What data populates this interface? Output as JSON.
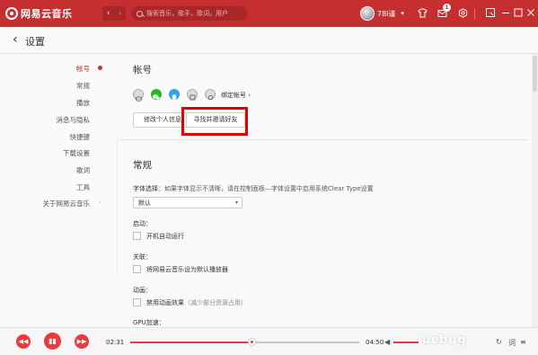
{
  "app": {
    "logo_text": "网易云音乐"
  },
  "titlebar": {
    "back": "‹",
    "forward": "›",
    "search_placeholder": "搜索音乐，歌手，歌词，用户",
    "username": "78l谨",
    "caret": "▾",
    "message_badge": "1",
    "icons": [
      "skin-icon",
      "message-icon",
      "settings-icon",
      "mini-mode-icon",
      "minimize-icon",
      "maximize-icon",
      "close-icon"
    ]
  },
  "header": {
    "back_icon": "‹",
    "title": "设置"
  },
  "sidebar": {
    "items": [
      "帐号",
      "常规",
      "播放",
      "消息与隐私",
      "快捷键",
      "下载设置",
      "歌词",
      "工具",
      "关于网易云音乐"
    ],
    "active_index": 0
  },
  "account": {
    "title": "帐号",
    "bind_link": "绑定帐号 ›",
    "edit_button": "修改个人信息",
    "invite_button": "寻找并邀请好友"
  },
  "general": {
    "title": "常规",
    "font_label": "字体选择：",
    "font_hint": "如果字体显示不清晰，请在控制面板—字体设置中启用系统Clear Type设置",
    "font_value": "默认",
    "startup_label": "启动：",
    "startup_option": "开机自动运行",
    "assoc_label": "关联：",
    "assoc_option": "将网易云音乐设为默认播放器",
    "anim_label": "动画：",
    "anim_option": "禁用动画效果",
    "anim_note": "（减少部分资源占用）",
    "gpu_label": "GPU加速："
  },
  "player": {
    "elapsed": "02:31",
    "duration": "04:50",
    "progress": 0.53,
    "volume": 0.7,
    "prev": "◀◀",
    "play": "▮▮",
    "next": "▶▶",
    "watermark": "ucbug"
  },
  "colors": {
    "brand": "#c62f2f",
    "accent": "#e83c3c",
    "highlight_box": "#e00000"
  }
}
